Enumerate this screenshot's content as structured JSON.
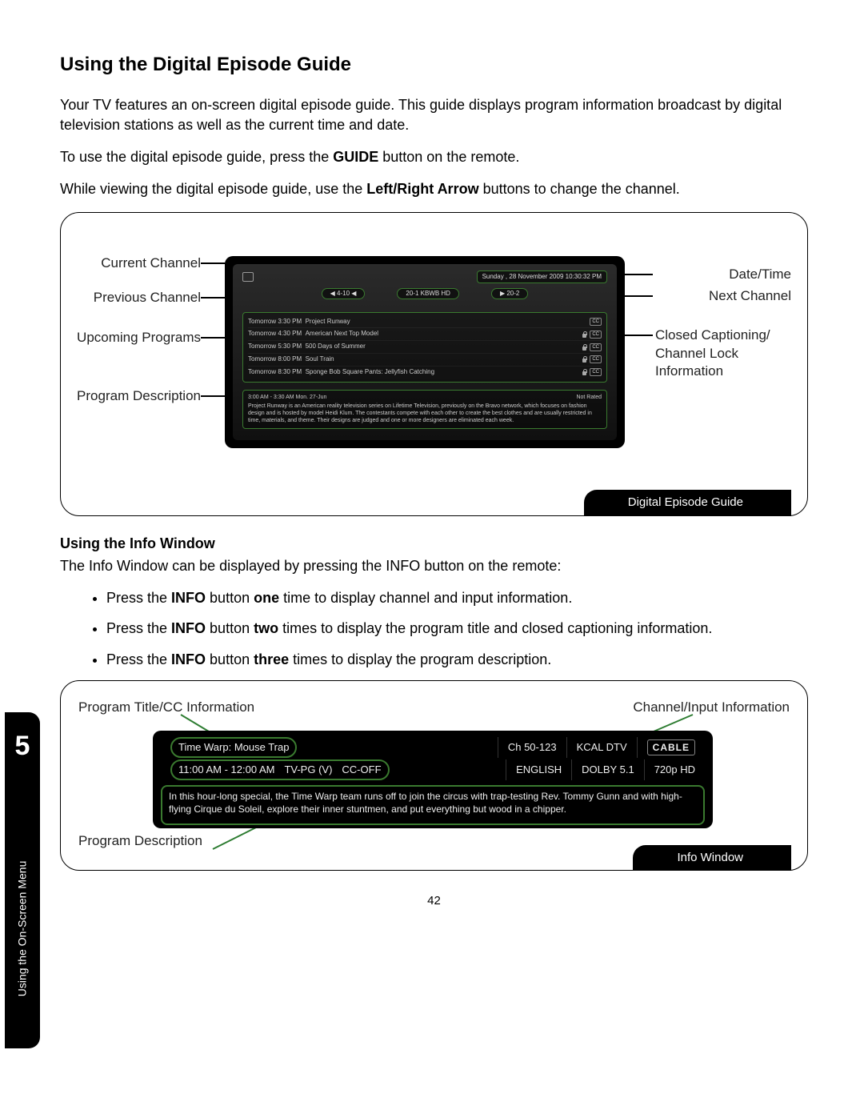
{
  "title": "Using the Digital Episode Guide",
  "intro1": "Your TV features an on-screen digital episode guide. This guide displays program information broadcast by digital television stations as well as the current time and date.",
  "intro2a": "To use the digital episode guide, press the ",
  "intro2b": "GUIDE",
  "intro2c": " button on the remote.",
  "intro3a": "While viewing the digital episode guide, use the ",
  "intro3b": "Left/Right Arrow",
  "intro3c": " buttons to change the channel.",
  "fig1": {
    "caption": "Digital Episode Guide",
    "datetime": "Sunday , 28 November 2009 10:30:32 PM",
    "ch_prev": "◀ 4-10 ◀",
    "ch_curr": "20-1 KBWB HD",
    "ch_next": "▶ 20-2",
    "upcoming": [
      {
        "t": "Tomorrow   3:30 PM",
        "p": "Project Runway"
      },
      {
        "t": "Tomorrow   4:30 PM",
        "p": "American Next Top Model"
      },
      {
        "t": "Tomorrow   5:30 PM",
        "p": "500 Days of Summer"
      },
      {
        "t": "Tomorrow   8:00 PM",
        "p": "Soul Train"
      },
      {
        "t": "Tomorrow   8:30 PM",
        "p": "Sponge Bob Square Pants: Jellyfish Catching"
      }
    ],
    "cc": "CC",
    "desc_head_left": "3:00 AM - 3:30 AM Mon. 27-Jun",
    "desc_head_right": "Not Rated",
    "desc": "Project Runway is an American reality television series on Lifetime Television, previously on the Bravo network, which focuses on fashion design and is hosted by model Heidi Klum. The contestants compete with each other to create the best clothes and are usually restricted in time, materials, and theme. Their designs are judged and one or more designers are eliminated each week.",
    "labels": {
      "current_channel": "Current Channel",
      "previous_channel": "Previous Channel",
      "upcoming_programs": "Upcoming Programs",
      "program_description": "Program Description",
      "date_time": "Date/Time",
      "next_channel": "Next Channel",
      "cc_lock": "Closed Captioning/ Channel Lock Information"
    }
  },
  "info_section": {
    "heading": "Using the Info Window",
    "intro": "The Info Window can be displayed by pressing the INFO button on the remote:",
    "b1a": "Press the ",
    "b1b": "INFO",
    "b1c": " button ",
    "b1d": "one",
    "b1e": " time to display channel and input information.",
    "b2a": "Press the ",
    "b2b": "INFO",
    "b2c": " button ",
    "b2d": "two",
    "b2e": " times to display the program title and closed captioning information.",
    "b3a": "Press the ",
    "b3b": "INFO",
    "b3c": " button ",
    "b3d": "three",
    "b3e": " times to display the program description."
  },
  "fig2": {
    "caption": "Info Window",
    "labels": {
      "title_cc": "Program Title/CC Information",
      "channel_input": "Channel/Input Information",
      "program_description": "Program Description"
    },
    "row1": {
      "title": "Time Warp: Mouse Trap",
      "ch": "Ch 50-123",
      "callsign": "KCAL DTV",
      "input": "CABLE"
    },
    "row2": {
      "time": "11:00 AM - 12:00 AM",
      "rating": "TV-PG (V)",
      "cc": "CC-OFF",
      "lang": "ENGLISH",
      "audio": "DOLBY 5.1",
      "res": "720p HD"
    },
    "desc": "In this hour-long special, the Time Warp team runs off to join the circus with trap-testing Rev. Tommy Gunn and with high-flying Cirque du Soleil, explore their inner stuntmen, and put everything but wood in a chipper."
  },
  "side": {
    "chapter": "5",
    "section": "Using the On-Screen Menu"
  },
  "page_number": "42"
}
